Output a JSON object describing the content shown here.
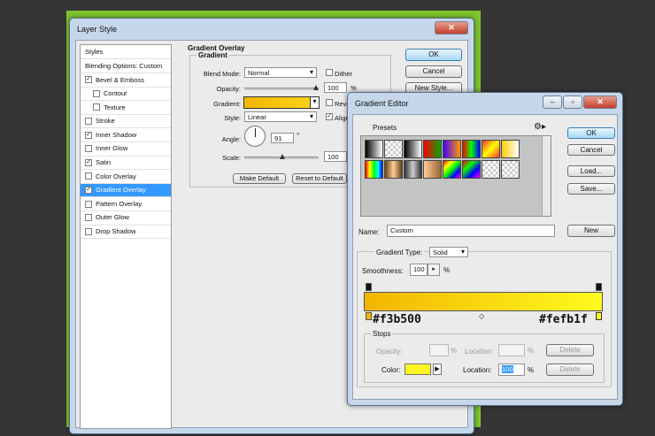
{
  "layer_style": {
    "title": "Layer Style",
    "styles_header": "Styles",
    "blending_options": "Blending Options: Custom",
    "items": [
      {
        "label": "Bevel & Emboss",
        "checked": true,
        "sub": false,
        "selected": false
      },
      {
        "label": "Contour",
        "checked": false,
        "sub": true,
        "selected": false
      },
      {
        "label": "Texture",
        "checked": false,
        "sub": true,
        "selected": false
      },
      {
        "label": "Stroke",
        "checked": false,
        "sub": false,
        "selected": false
      },
      {
        "label": "Inner Shadow",
        "checked": true,
        "sub": false,
        "selected": false
      },
      {
        "label": "Inner Glow",
        "checked": false,
        "sub": false,
        "selected": false
      },
      {
        "label": "Satin",
        "checked": true,
        "sub": false,
        "selected": false
      },
      {
        "label": "Color Overlay",
        "checked": false,
        "sub": false,
        "selected": false
      },
      {
        "label": "Gradient Overlay",
        "checked": true,
        "sub": false,
        "selected": true
      },
      {
        "label": "Pattern Overlay",
        "checked": false,
        "sub": false,
        "selected": false
      },
      {
        "label": "Outer Glow",
        "checked": false,
        "sub": false,
        "selected": false
      },
      {
        "label": "Drop Shadow",
        "checked": false,
        "sub": false,
        "selected": false
      }
    ],
    "section_title": "Gradient Overlay",
    "group_title": "Gradient",
    "blend_mode_label": "Blend Mode:",
    "blend_mode_value": "Normal",
    "dither_label": "Dither",
    "opacity_label": "Opacity:",
    "opacity_value": "100",
    "opacity_unit": "%",
    "gradient_label": "Gradient:",
    "reverse_label": "Reve",
    "style_label": "Style:",
    "style_value": "Linear",
    "align_label": "Align",
    "angle_label": "Angle:",
    "angle_value": "91",
    "angle_unit": "°",
    "scale_label": "Scale:",
    "scale_value": "100",
    "make_default": "Make Default",
    "reset_default": "Reset to Default",
    "ok": "OK",
    "cancel": "Cancel",
    "new_style": "New Style..."
  },
  "gradient_editor": {
    "title": "Gradient Editor",
    "presets_label": "Presets",
    "ok": "OK",
    "cancel": "Cancel",
    "load": "Load...",
    "save": "Save...",
    "name_label": "Name:",
    "name_value": "Custom",
    "new": "New",
    "gradient_type_label": "Gradient Type:",
    "gradient_type_value": "Solid",
    "smoothness_label": "Smoothness:",
    "smoothness_value": "100",
    "smoothness_unit": "%",
    "start_color": "#f3b500",
    "end_color": "#fefb1f",
    "stops_label": "Stops",
    "opacity_label": "Opacity:",
    "opacity_unit": "%",
    "location_label": "Location:",
    "location_unit": "%",
    "delete": "Delete",
    "color_label": "Color:",
    "color_location_value": "100",
    "stop_color": "#fff523"
  }
}
